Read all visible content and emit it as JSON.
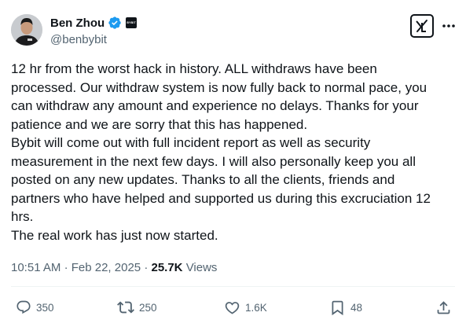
{
  "author": {
    "display_name": "Ben Zhou",
    "handle": "@benbybit",
    "affiliation_badge": "BYBIT"
  },
  "tweet": {
    "lines": [
      "12 hr from the worst hack in history. ALL withdraws have been",
      "processed. Our withdraw system is now fully back to normal pace, you",
      "can withdraw any amount and experience no delays. Thanks for your",
      "patience and we are sorry that this has happened.",
      "Bybit will come out with full incident report as well as security",
      "measurement in the next few days. I will also personally keep you all",
      "posted on any new updates. Thanks to all the clients, friends and",
      "partners who have helped and supported us during this excruciation 12",
      "hrs.",
      "The real work has just now started."
    ]
  },
  "meta": {
    "time": "10:51 AM",
    "separator": "·",
    "date": "Feb 22, 2025",
    "views_count": "25.7K",
    "views_label": "Views"
  },
  "actions": {
    "replies": "350",
    "reposts": "250",
    "likes": "1.6K",
    "bookmarks": "48"
  },
  "icons": {
    "verified": "verified-badge-icon",
    "grok": "grok-icon",
    "more": "more-icon",
    "reply": "reply-icon",
    "repost": "repost-icon",
    "like": "like-icon",
    "bookmark": "bookmark-icon",
    "share": "share-icon"
  },
  "colors": {
    "text": "#0f1419",
    "secondary": "#536471",
    "verified": "#1d9bf0",
    "divider": "#eff3f4"
  }
}
